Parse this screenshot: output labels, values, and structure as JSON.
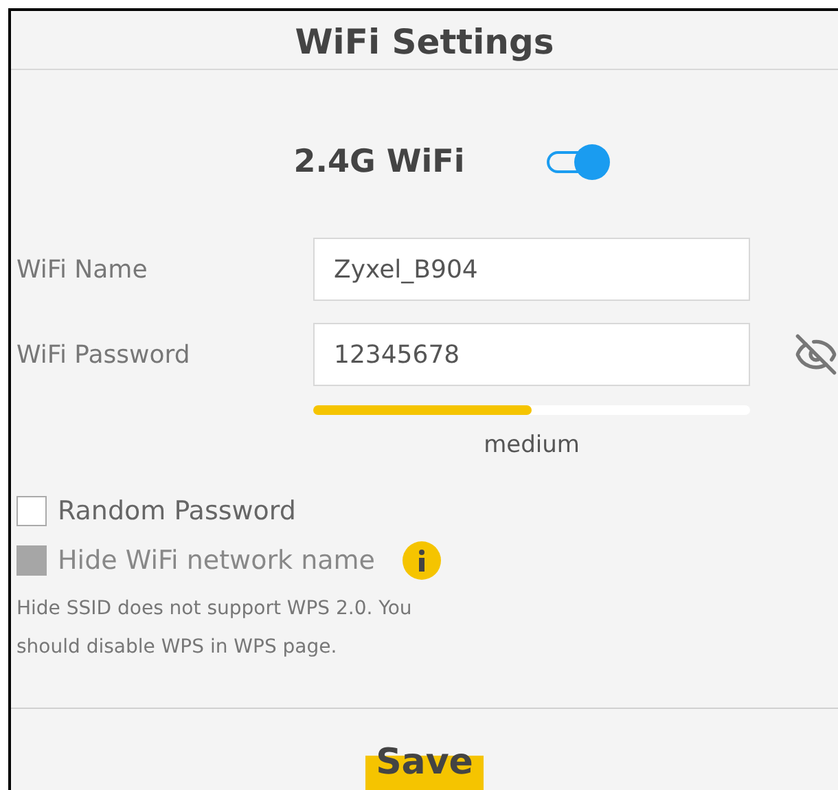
{
  "title": "WiFi Settings",
  "band": {
    "label": "2.4G WiFi",
    "on": true
  },
  "fields": [
    {
      "label": "WiFi Name",
      "value": "Zyxel_B904",
      "kind": "text"
    },
    {
      "label": "WiFi Password",
      "value": "12345678",
      "kind": "password"
    }
  ],
  "strength": {
    "level": 0.5,
    "label": "medium"
  },
  "options": [
    {
      "label": "Random Password",
      "checked": false,
      "disabled": false,
      "info": false
    },
    {
      "label": "Hide WiFi network name",
      "checked": false,
      "disabled": true,
      "info": true
    }
  ],
  "note": "Hide SSID does not support WPS 2.0. You should disable WPS in WPS page.",
  "save": "Save"
}
